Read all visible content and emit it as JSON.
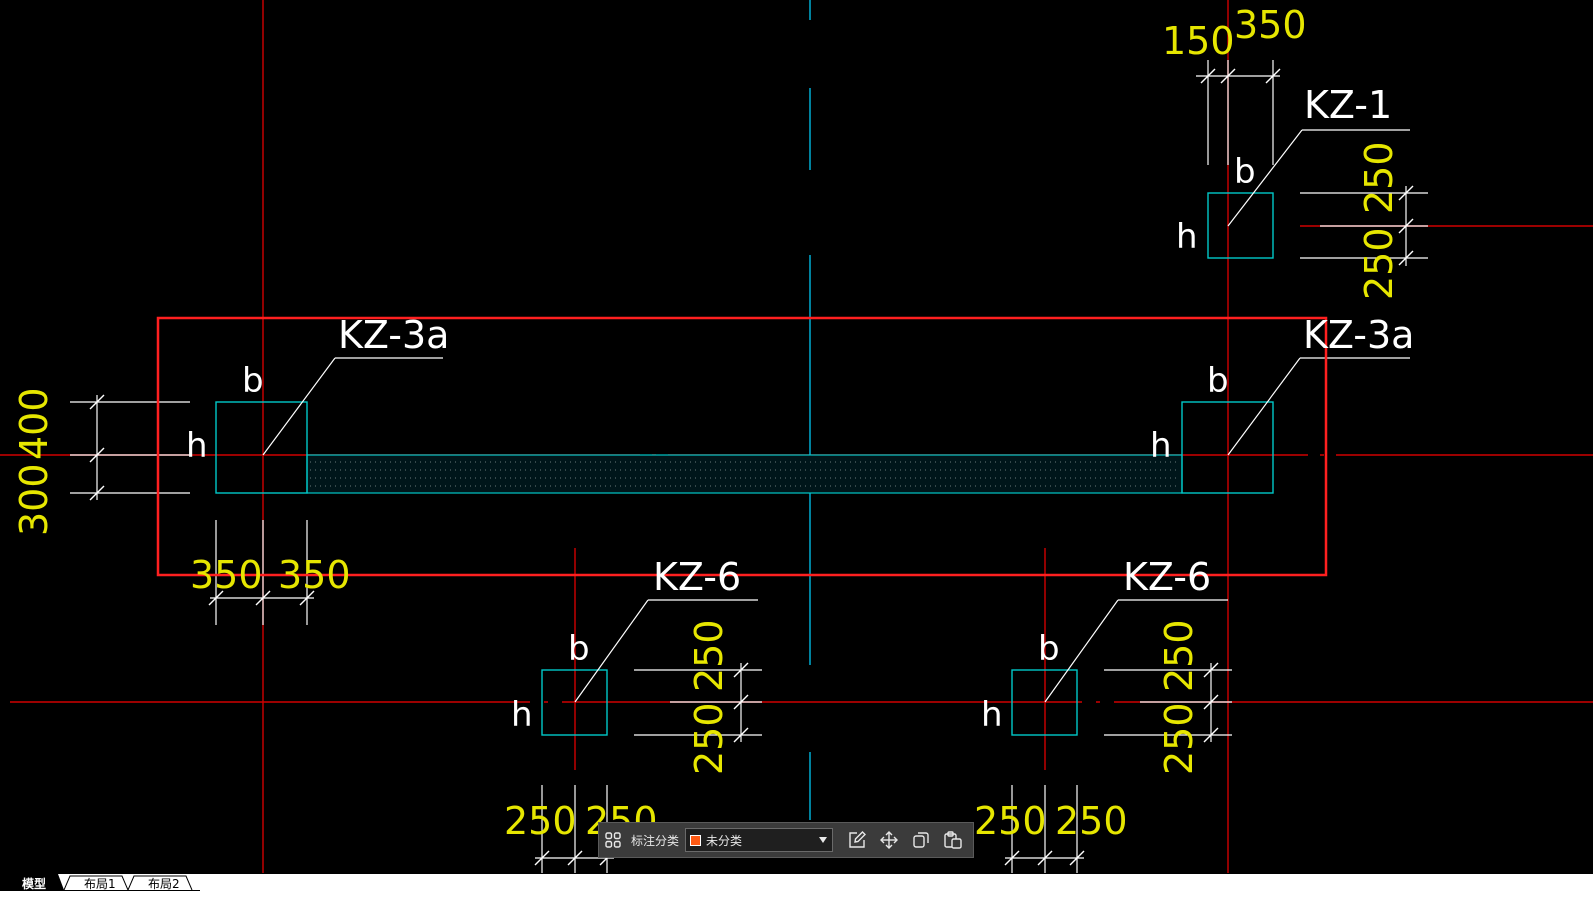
{
  "drawing": {
    "columns": [
      {
        "tag": "KZ-1",
        "b": "b",
        "h": "h",
        "dims": [
          "150",
          "350",
          "250",
          "250"
        ]
      },
      {
        "tag": "KZ-3a",
        "b": "b",
        "h": "h",
        "dims": [
          "400",
          "300",
          "350",
          "350"
        ]
      },
      {
        "tag": "KZ-3a",
        "b": "b",
        "h": "h"
      },
      {
        "tag": "KZ-6",
        "b": "b",
        "h": "h",
        "dims": [
          "250",
          "250",
          "250",
          "250"
        ]
      },
      {
        "tag": "KZ-6",
        "b": "b",
        "h": "h",
        "dims": [
          "250",
          "250",
          "250",
          "250"
        ]
      }
    ]
  },
  "toolbar": {
    "category_label": "标注分类",
    "category_value": "未分类",
    "category_color": "#ff5a14",
    "icons": [
      "grid-icon",
      "edit-icon",
      "move-icon",
      "copy-icon",
      "paste-icon"
    ]
  },
  "tabs": [
    {
      "label": "模型",
      "active": true
    },
    {
      "label": "布局1",
      "active": false
    },
    {
      "label": "布局2",
      "active": false
    }
  ],
  "colors": {
    "background": "#000000",
    "axis": "#e00000",
    "column_outline": "#00c8c8",
    "dimension_text": "#e6e600",
    "selection": "#ff2020"
  }
}
